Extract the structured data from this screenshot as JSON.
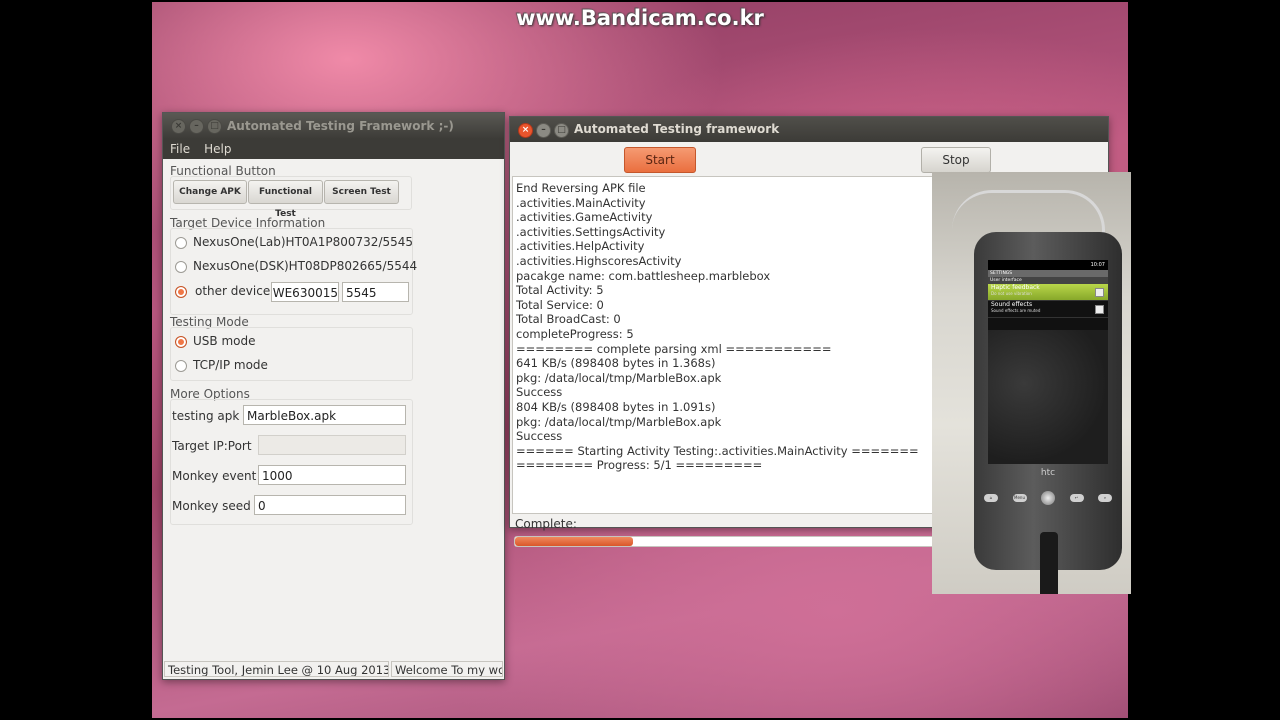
{
  "watermark": "www.Bandicam.co.kr",
  "main_window": {
    "title": "Automated Testing Framework ;-)",
    "menu": [
      "File",
      "Help"
    ],
    "functional": {
      "label": "Functional Button",
      "buttons": [
        "Change APK",
        "Functional Test",
        "Screen Test"
      ]
    },
    "target": {
      "label": "Target Device Information",
      "devices": [
        {
          "label": "NexusOne(Lab)HT0A1P800732/5545",
          "selected": false
        },
        {
          "label": "NexusOne(DSK)HT08DP802665/5544",
          "selected": false
        },
        {
          "label": "other device",
          "selected": true
        }
      ],
      "other_serial": "WE630015",
      "other_port": "5545"
    },
    "mode": {
      "label": "Testing Mode",
      "options": [
        {
          "label": "USB mode",
          "selected": true
        },
        {
          "label": "TCP/IP mode",
          "selected": false
        }
      ]
    },
    "options": {
      "label": "More Options",
      "testing_apk_label": "testing apk",
      "testing_apk_value": "MarbleBox.apk",
      "target_ip_label": "Target IP:Port",
      "target_ip_value": "",
      "monkey_event_label": "Monkey event",
      "monkey_event_value": "1000",
      "monkey_seed_label": "Monkey seed",
      "monkey_seed_value": "0"
    },
    "status": {
      "left": "Testing Tool, Jemin Lee @ 10 Aug 2013",
      "right": "Welcome To my world"
    }
  },
  "test_window": {
    "title": "Automated Testing framework",
    "start_label": "Start",
    "stop_label": "Stop",
    "log_lines": [
      "End Reversing APK file",
      ".activities.MainActivity",
      ".activities.GameActivity",
      ".activities.SettingsActivity",
      ".activities.HelpActivity",
      ".activities.HighscoresActivity",
      "pacakge name: com.battlesheep.marblebox",
      "Total Activity: 5",
      "Total Service: 0",
      "Total BroadCast: 0",
      "completeProgress: 5",
      "======== complete parsing xml ===========",
      "641 KB/s (898408 bytes in 1.368s)",
      "      pkg: /data/local/tmp/MarbleBox.apk",
      "Success",
      "804 KB/s (898408 bytes in 1.091s)",
      "      pkg: /data/local/tmp/MarbleBox.apk",
      "Success",
      "====== Starting Activity Testing:.activities.MainActivity =======",
      "======== Progress: 5/1 ========="
    ],
    "complete_label": "Complete:",
    "progress_fraction": 0.2
  },
  "phone": {
    "status_time": "10:07",
    "header": "SETTINGS",
    "section": "User interface",
    "rows": [
      {
        "title": "Haptic feedback",
        "sub": "Do not use vibration"
      },
      {
        "title": "Sound effects",
        "sub": "Sound effects are muted"
      }
    ],
    "brand": "htc",
    "menu_key": "Menu"
  }
}
